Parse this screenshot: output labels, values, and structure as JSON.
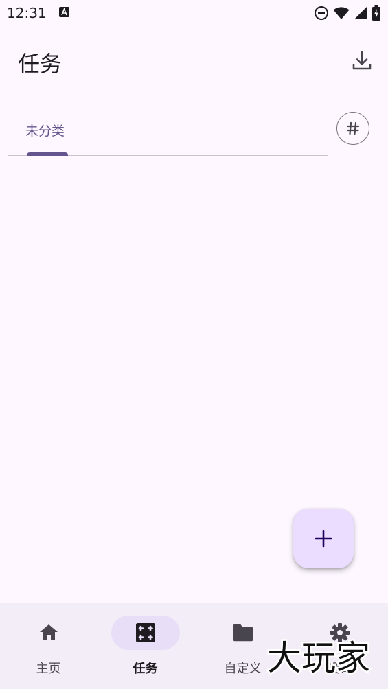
{
  "status_bar": {
    "time": "12:31",
    "notification_icon": "font-a-icon",
    "icons": [
      "do-not-disturb-icon",
      "wifi-icon",
      "cellular-signal-icon",
      "battery-charging-icon"
    ]
  },
  "app_bar": {
    "title": "任务",
    "download_icon": "download-icon"
  },
  "tabs": {
    "items": [
      {
        "label": "未分类",
        "selected": true
      }
    ],
    "category_icon": "hashtag-icon"
  },
  "fab": {
    "icon": "plus-icon"
  },
  "bottom_nav": {
    "items": [
      {
        "label": "主页",
        "icon": "home-icon",
        "active": false
      },
      {
        "label": "任务",
        "icon": "tasks-icon",
        "active": true
      },
      {
        "label": "自定义",
        "icon": "folder-icon",
        "active": false
      },
      {
        "label": "设置",
        "icon": "gear-icon",
        "active": false
      }
    ]
  },
  "watermark": {
    "text": "大玩家"
  },
  "colors": {
    "background": "#fef7ff",
    "primary": "#65558f",
    "nav_background": "#f3edf7",
    "nav_active_pill": "#e8def8",
    "fab_background": "#eaddff"
  }
}
